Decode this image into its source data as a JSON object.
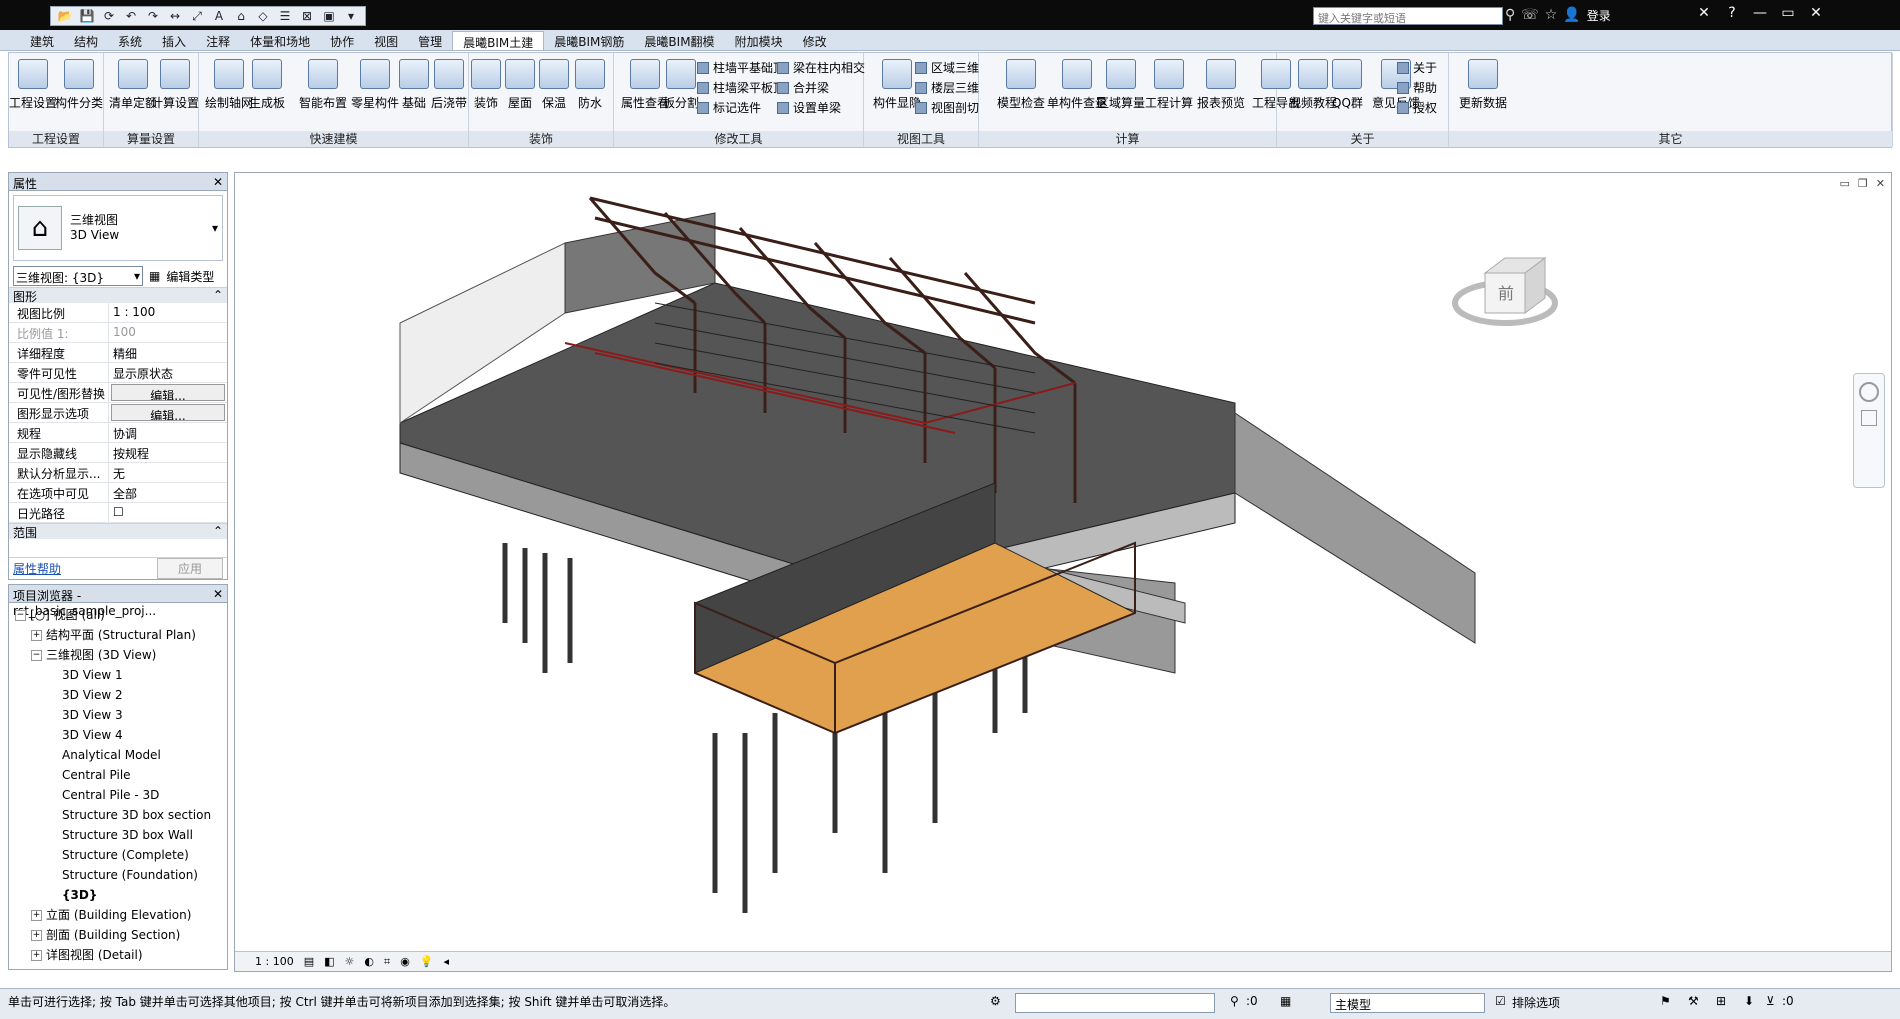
{
  "search": {
    "placeholder": "键入关键字或短语"
  },
  "login_label": "登录",
  "tabs": [
    "建筑",
    "结构",
    "系统",
    "插入",
    "注释",
    "体量和场地",
    "协作",
    "视图",
    "管理",
    "晨曦BIM土建",
    "晨曦BIM钢筋",
    "晨曦BIM翻模",
    "附加模块",
    "修改"
  ],
  "active_tab": 9,
  "ribbon": {
    "panels": [
      {
        "title": "工程设置"
      },
      {
        "title": "算量设置"
      },
      {
        "title": "快速建模"
      },
      {
        "title": "装饰"
      },
      {
        "title": "修改工具"
      },
      {
        "title": "视图工具"
      },
      {
        "title": "计算"
      },
      {
        "title": "关于"
      },
      {
        "title": "其它"
      }
    ],
    "buttons": [
      "工程设置",
      "构件分类",
      "清单定额",
      "计算设置",
      "绘制轴网",
      "生成板",
      "智能布置",
      "零星构件",
      "基础",
      "后浇带",
      "装饰",
      "屋面",
      "保温",
      "防水",
      "属性查看",
      "板分割",
      "构件显隐",
      "模型检查",
      "单构件查量",
      "区域算量",
      "工程计算",
      "报表预览",
      "工程导出",
      "视频教程",
      "QQ群",
      "意见反馈",
      "更新数据"
    ],
    "small": [
      "柱墙平基础顶",
      "柱墙梁平板顶",
      "标记选件",
      "梁在柱内相交",
      "合并梁",
      "设置单梁",
      "区域三维",
      "楼层三维",
      "视图剖切",
      "关于",
      "帮助",
      "授权"
    ]
  },
  "properties": {
    "title": "属性",
    "type_line1": "三维视图",
    "type_line2": "3D View",
    "view_selector": "三维视图: {3D}",
    "edit_type": "编辑类型",
    "section_graphics": "图形",
    "rows": [
      {
        "k": "视图比例",
        "v": "1 : 100"
      },
      {
        "k": "比例值 1:",
        "v": "100"
      },
      {
        "k": "详细程度",
        "v": "精细"
      },
      {
        "k": "零件可见性",
        "v": "显示原状态"
      },
      {
        "k": "可见性/图形替换",
        "v": "编辑..."
      },
      {
        "k": "图形显示选项",
        "v": "编辑..."
      },
      {
        "k": "规程",
        "v": "协调"
      },
      {
        "k": "显示隐藏线",
        "v": "按规程"
      },
      {
        "k": "默认分析显示...",
        "v": "无"
      },
      {
        "k": "在选项中可见",
        "v": "全部"
      },
      {
        "k": "日光路径",
        "v": ""
      }
    ],
    "section_scope": "范围",
    "help_link": "属性帮助",
    "apply": "应用"
  },
  "browser": {
    "title": "项目浏览器 - rst_basic_sample_proj...",
    "items": [
      {
        "label": "[○] 视图 (all)",
        "level": 0,
        "tog": "−"
      },
      {
        "label": "结构平面 (Structural Plan)",
        "level": 1,
        "tog": "+"
      },
      {
        "label": "三维视图 (3D View)",
        "level": 1,
        "tog": "−"
      },
      {
        "label": "3D View 1",
        "level": 2
      },
      {
        "label": "3D View 2",
        "level": 2
      },
      {
        "label": "3D View 3",
        "level": 2
      },
      {
        "label": "3D View 4",
        "level": 2
      },
      {
        "label": "Analytical Model",
        "level": 2
      },
      {
        "label": "Central Pile",
        "level": 2
      },
      {
        "label": "Central Pile - 3D",
        "level": 2
      },
      {
        "label": "Structure 3D box section",
        "level": 2
      },
      {
        "label": "Structure 3D box Wall",
        "level": 2
      },
      {
        "label": "Structure (Complete)",
        "level": 2
      },
      {
        "label": "Structure (Foundation)",
        "level": 2
      },
      {
        "label": "{3D}",
        "level": 2,
        "bold": true
      },
      {
        "label": "立面 (Building Elevation)",
        "level": 1,
        "tog": "+"
      },
      {
        "label": "剖面 (Building Section)",
        "level": 1,
        "tog": "+"
      },
      {
        "label": "详图视图 (Detail)",
        "level": 1,
        "tog": "+"
      }
    ]
  },
  "viewcube": {
    "face": "前"
  },
  "viewport_scale": "1 : 100",
  "status_text": "单击可进行选择; 按 Tab 键并单击可选择其他项目; 按 Ctrl 键并单击可将新项目添加到选择集; 按 Shift 键并单击可取消选择。",
  "status_count1": ":0",
  "model_dropdown": "主模型",
  "exclude_options": "排除选项",
  "status_count2": ":0"
}
